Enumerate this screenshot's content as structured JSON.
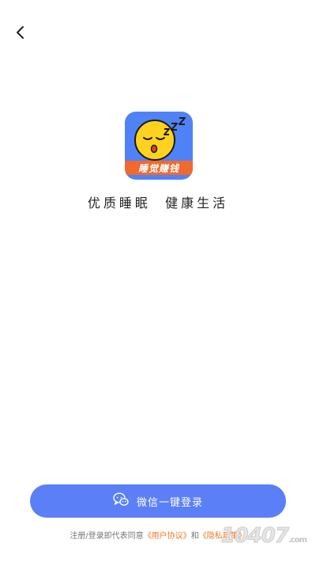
{
  "icons": {
    "back": "chevron-left-icon",
    "wechat": "wechat-icon"
  },
  "logo": {
    "banner_text": "睡觉赚钱",
    "bg_color": "#4f82f6",
    "banner_color": "#f06a2e",
    "face_color": "#ffd21f"
  },
  "slogan": "优质睡眠  健康生活",
  "login": {
    "wechat_button_label": "微信一键登录",
    "button_color": "#5b7ff7"
  },
  "agreement": {
    "prefix": "注册/登录即代表同意",
    "user_agreement": "《用户协议》",
    "and": "和",
    "privacy_policy": "《隐私政策》",
    "link_color": "#f07a25"
  },
  "watermark": {
    "text": "10407",
    "suffix": ".com"
  }
}
